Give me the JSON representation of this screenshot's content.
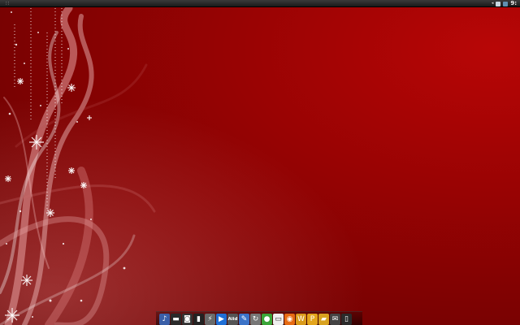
{
  "topbar": {
    "menu_glyph": "∷",
    "clock": "9:",
    "tray_arrow": "◂"
  },
  "dock": {
    "items": [
      {
        "name": "sound-icon",
        "glyph": "♪",
        "color": "#3a5fa8"
      },
      {
        "name": "keyboard-icon",
        "glyph": "▬",
        "color": "#2a2a2a"
      },
      {
        "name": "camera-icon",
        "glyph": "◙",
        "color": "#333333"
      },
      {
        "name": "terminal-icon",
        "glyph": "▮",
        "color": "#222222"
      },
      {
        "name": "flash-icon",
        "glyph": "⚡",
        "color": "#6a6a6a"
      },
      {
        "name": "media-player-icon",
        "glyph": "▶",
        "color": "#1f6fd6"
      },
      {
        "name": "aiid-icon",
        "glyph": "Aiid",
        "color": "#555555"
      },
      {
        "name": "pen-icon",
        "glyph": "✎",
        "color": "#3b73c8"
      },
      {
        "name": "refresh-icon",
        "glyph": "↻",
        "color": "#777777"
      },
      {
        "name": "green-app-icon",
        "glyph": "●",
        "color": "#3aa538"
      },
      {
        "name": "monitor-icon",
        "glyph": "▭",
        "color": "#eeeeee"
      },
      {
        "name": "firefox-icon",
        "glyph": "◉",
        "color": "#e66a12"
      },
      {
        "name": "wordpress-icon",
        "glyph": "W",
        "color": "#d99a1a"
      },
      {
        "name": "p-app-icon",
        "glyph": "P",
        "color": "#e3a51c"
      },
      {
        "name": "folder-icon",
        "glyph": "▰",
        "color": "#d9a220"
      },
      {
        "name": "mail-icon",
        "glyph": "✉",
        "color": "#444444"
      },
      {
        "name": "trash-icon",
        "glyph": "▯",
        "color": "#2b2b2b"
      }
    ]
  }
}
